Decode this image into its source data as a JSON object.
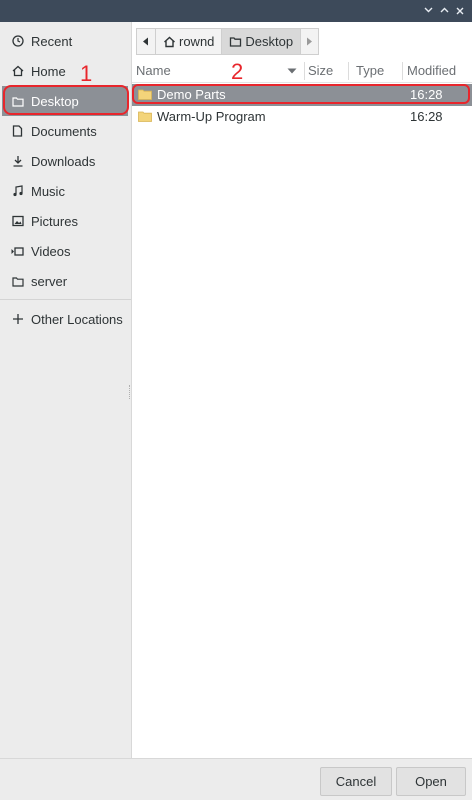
{
  "window": {
    "controls": [
      "minimize",
      "maximize",
      "close"
    ]
  },
  "sidebar": {
    "items": [
      {
        "label": "Recent",
        "icon": "clock-icon"
      },
      {
        "label": "Home",
        "icon": "home-icon"
      },
      {
        "label": "Desktop",
        "icon": "folder-icon",
        "selected": true
      },
      {
        "label": "Documents",
        "icon": "document-icon"
      },
      {
        "label": "Downloads",
        "icon": "download-icon"
      },
      {
        "label": "Music",
        "icon": "music-icon"
      },
      {
        "label": "Pictures",
        "icon": "picture-icon"
      },
      {
        "label": "Videos",
        "icon": "video-icon"
      },
      {
        "label": "server",
        "icon": "folder-icon"
      }
    ],
    "other_locations": {
      "label": "Other Locations",
      "icon": "plus-icon"
    }
  },
  "pathbar": {
    "crumbs": [
      {
        "label": "rownd",
        "icon": "home-icon"
      },
      {
        "label": "Desktop",
        "icon": "folder-icon",
        "active": true
      }
    ]
  },
  "file_list": {
    "columns": {
      "name": "Name",
      "size": "Size",
      "type": "Type",
      "modified": "Modified"
    },
    "rows": [
      {
        "name": "Demo Parts",
        "size": "",
        "type": "",
        "modified": "16:28",
        "selected": true
      },
      {
        "name": "Warm-Up Program",
        "size": "",
        "type": "",
        "modified": "16:28",
        "selected": false
      }
    ]
  },
  "footer": {
    "cancel_label": "Cancel",
    "open_label": "Open"
  },
  "annotations": [
    {
      "label": "1",
      "target": "sidebar-item-desktop"
    },
    {
      "label": "2",
      "target": "file-row-demo-parts"
    }
  ],
  "colors": {
    "selection": "#8c9096",
    "annotation": "#e8262c",
    "titlebar": "#3d4a5a",
    "folder": "#f3d47a"
  }
}
